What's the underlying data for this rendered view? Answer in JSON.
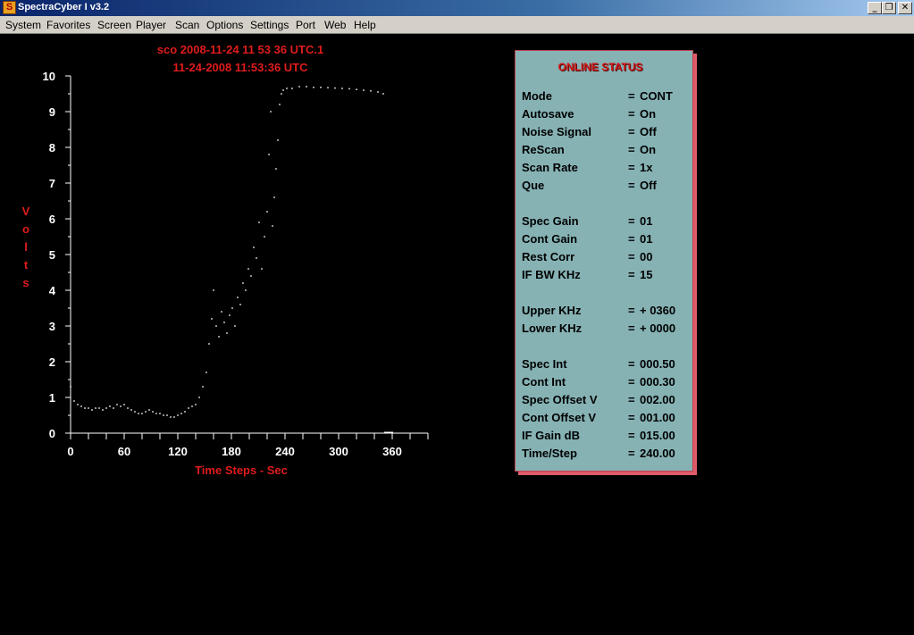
{
  "window": {
    "title": "SpectraCyber I v3.2",
    "controls": [
      "_",
      "❐",
      "✕"
    ]
  },
  "menu": [
    "System",
    "Favorites",
    "Screen",
    "Player",
    "Scan",
    "Options",
    "Settings",
    "Port",
    "Web",
    "Help"
  ],
  "plot": {
    "header_line1": "sco 2008-11-24 11 53 36 UTC.1",
    "header_line2": "11-24-2008 11:53:36 UTC",
    "ylabel_letters": [
      "V",
      "o",
      "l",
      "t",
      "s"
    ],
    "xlabel": "Time Steps - Sec"
  },
  "chart_data": {
    "type": "scatter",
    "title": "sco 2008-11-24 11 53 36 UTC.1",
    "subtitle": "11-24-2008 11:53:36 UTC",
    "xlabel": "Time Steps - Sec",
    "ylabel": "Volts",
    "xlim": [
      0,
      400
    ],
    "ylim": [
      0,
      10
    ],
    "xticks": [
      0,
      60,
      120,
      180,
      240,
      300,
      360
    ],
    "yticks": [
      0,
      1,
      2,
      3,
      4,
      5,
      6,
      7,
      8,
      9,
      10
    ],
    "grid": false,
    "colors": {
      "axes": "#ffffff",
      "labels": "#e01c1c",
      "points": "#ffffff"
    },
    "series": [
      {
        "x": [
          0,
          4,
          8,
          12,
          16,
          20,
          24,
          28,
          32,
          36,
          40,
          44,
          48,
          52,
          56,
          60,
          64,
          68,
          72,
          76,
          80,
          84,
          88,
          92,
          96,
          100,
          104,
          108,
          112,
          116,
          120,
          124,
          128,
          132,
          136,
          140,
          144,
          148,
          152,
          155,
          158,
          160,
          163,
          166,
          169,
          172,
          175,
          178,
          181,
          184,
          187,
          190,
          193,
          196,
          199,
          202,
          205,
          208,
          211,
          214,
          217,
          220,
          222,
          224,
          226,
          228,
          230,
          232,
          234,
          236,
          238,
          242,
          248,
          256,
          264,
          272,
          280,
          288,
          296,
          304,
          312,
          320,
          328,
          336,
          344,
          350
        ],
        "y": [
          1.3,
          0.9,
          0.8,
          0.75,
          0.7,
          0.7,
          0.65,
          0.7,
          0.7,
          0.65,
          0.7,
          0.75,
          0.7,
          0.8,
          0.75,
          0.8,
          0.7,
          0.65,
          0.6,
          0.55,
          0.55,
          0.6,
          0.65,
          0.6,
          0.55,
          0.55,
          0.5,
          0.5,
          0.45,
          0.45,
          0.5,
          0.55,
          0.6,
          0.7,
          0.75,
          0.8,
          1.0,
          1.3,
          1.7,
          2.5,
          3.2,
          4.0,
          3.0,
          2.7,
          3.4,
          3.1,
          2.8,
          3.3,
          3.5,
          3.0,
          3.8,
          3.6,
          4.2,
          4.0,
          4.6,
          4.4,
          5.2,
          4.9,
          5.9,
          4.6,
          5.5,
          6.2,
          7.8,
          9.0,
          5.8,
          6.6,
          7.4,
          8.2,
          9.2,
          9.5,
          9.6,
          9.65,
          9.65,
          9.7,
          9.7,
          9.68,
          9.68,
          9.67,
          9.66,
          9.65,
          9.64,
          9.62,
          9.6,
          9.58,
          9.55,
          9.5
        ]
      }
    ]
  },
  "status": {
    "title": "ONLINE STATUS",
    "rows": [
      {
        "label": "Mode",
        "eq": "=",
        "value": "CONT"
      },
      {
        "label": "Autosave",
        "eq": "=",
        "value": "On"
      },
      {
        "label": "Noise Signal",
        "eq": "=",
        "value": "Off"
      },
      {
        "label": "ReScan",
        "eq": "=",
        "value": "On"
      },
      {
        "label": "Scan Rate",
        "eq": "=",
        "value": "1x"
      },
      {
        "label": "Que",
        "eq": "=",
        "value": "Off"
      },
      {
        "label": "Spec Gain",
        "eq": "=",
        "value": "01"
      },
      {
        "label": "Cont Gain",
        "eq": "=",
        "value": "01"
      },
      {
        "label": "Rest Corr",
        "eq": "=",
        "value": "00"
      },
      {
        "label": "IF BW KHz",
        "eq": "=",
        "value": "15"
      },
      {
        "label": "Upper KHz",
        "eq": "=",
        "value": "+ 0360"
      },
      {
        "label": "Lower KHz",
        "eq": "=",
        "value": "+ 0000"
      },
      {
        "label": "Spec Int",
        "eq": "=",
        "value": "000.50"
      },
      {
        "label": "Cont Int",
        "eq": "=",
        "value": "000.30"
      },
      {
        "label": "Spec Offset V",
        "eq": "=",
        "value": "002.00"
      },
      {
        "label": "Cont Offset V",
        "eq": "=",
        "value": "001.00"
      },
      {
        "label": "IF Gain dB",
        "eq": "=",
        "value": "015.00"
      },
      {
        "label": "Time/Step",
        "eq": "=",
        "value": "240.00"
      }
    ]
  }
}
